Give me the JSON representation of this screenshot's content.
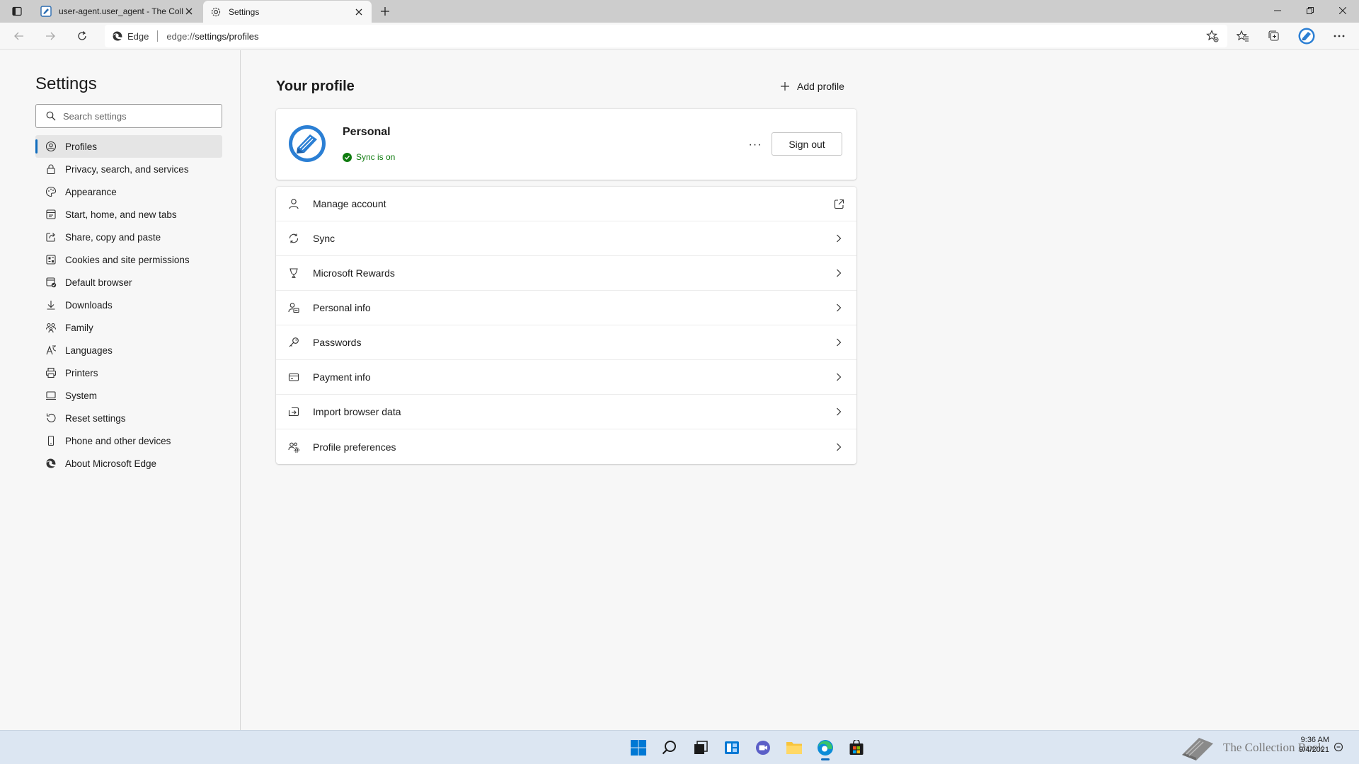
{
  "tabs": [
    {
      "title": "user-agent.user_agent - The Coll",
      "active": false
    },
    {
      "title": "Settings",
      "active": true
    }
  ],
  "toolbar": {
    "site_label": "Edge",
    "url_prefix": "edge://",
    "url_rest": "settings/profiles"
  },
  "sidebar": {
    "title": "Settings",
    "search_placeholder": "Search settings",
    "items": [
      {
        "label": "Profiles",
        "icon": "profile-icon",
        "selected": true
      },
      {
        "label": "Privacy, search, and services",
        "icon": "lock-icon"
      },
      {
        "label": "Appearance",
        "icon": "palette-icon"
      },
      {
        "label": "Start, home, and new tabs",
        "icon": "home-tab-icon"
      },
      {
        "label": "Share, copy and paste",
        "icon": "share-icon"
      },
      {
        "label": "Cookies and site permissions",
        "icon": "cookies-icon"
      },
      {
        "label": "Default browser",
        "icon": "default-browser-icon"
      },
      {
        "label": "Downloads",
        "icon": "download-icon"
      },
      {
        "label": "Family",
        "icon": "family-icon"
      },
      {
        "label": "Languages",
        "icon": "languages-icon"
      },
      {
        "label": "Printers",
        "icon": "printer-icon"
      },
      {
        "label": "System",
        "icon": "system-icon"
      },
      {
        "label": "Reset settings",
        "icon": "reset-icon"
      },
      {
        "label": "Phone and other devices",
        "icon": "phone-icon"
      },
      {
        "label": "About Microsoft Edge",
        "icon": "edge-logo-icon"
      }
    ]
  },
  "main": {
    "heading": "Your profile",
    "add_profile_label": "Add profile",
    "profile": {
      "name": "Personal",
      "sync_status": "Sync is on",
      "more_label": "···",
      "signout_label": "Sign out"
    },
    "rows": [
      {
        "label": "Manage account",
        "icon": "person-icon",
        "end": "external-link-icon"
      },
      {
        "label": "Sync",
        "icon": "sync-icon",
        "end": "chevron-right-icon"
      },
      {
        "label": "Microsoft Rewards",
        "icon": "trophy-icon",
        "end": "chevron-right-icon"
      },
      {
        "label": "Personal info",
        "icon": "person-card-icon",
        "end": "chevron-right-icon"
      },
      {
        "label": "Passwords",
        "icon": "key-icon",
        "end": "chevron-right-icon"
      },
      {
        "label": "Payment info",
        "icon": "card-icon",
        "end": "chevron-right-icon"
      },
      {
        "label": "Import browser data",
        "icon": "import-icon",
        "end": "chevron-right-icon"
      },
      {
        "label": "Profile preferences",
        "icon": "people-gear-icon",
        "end": "chevron-right-icon"
      }
    ]
  },
  "taskbar": {
    "watermark_text": "The Collection Book",
    "time": "9:36 AM",
    "date": "9/4/2021"
  },
  "colors": {
    "accent": "#0f6cbd",
    "sync_green": "#107c10",
    "tabstrip": "#cdcdcd",
    "taskbar": "#dce6f2"
  }
}
